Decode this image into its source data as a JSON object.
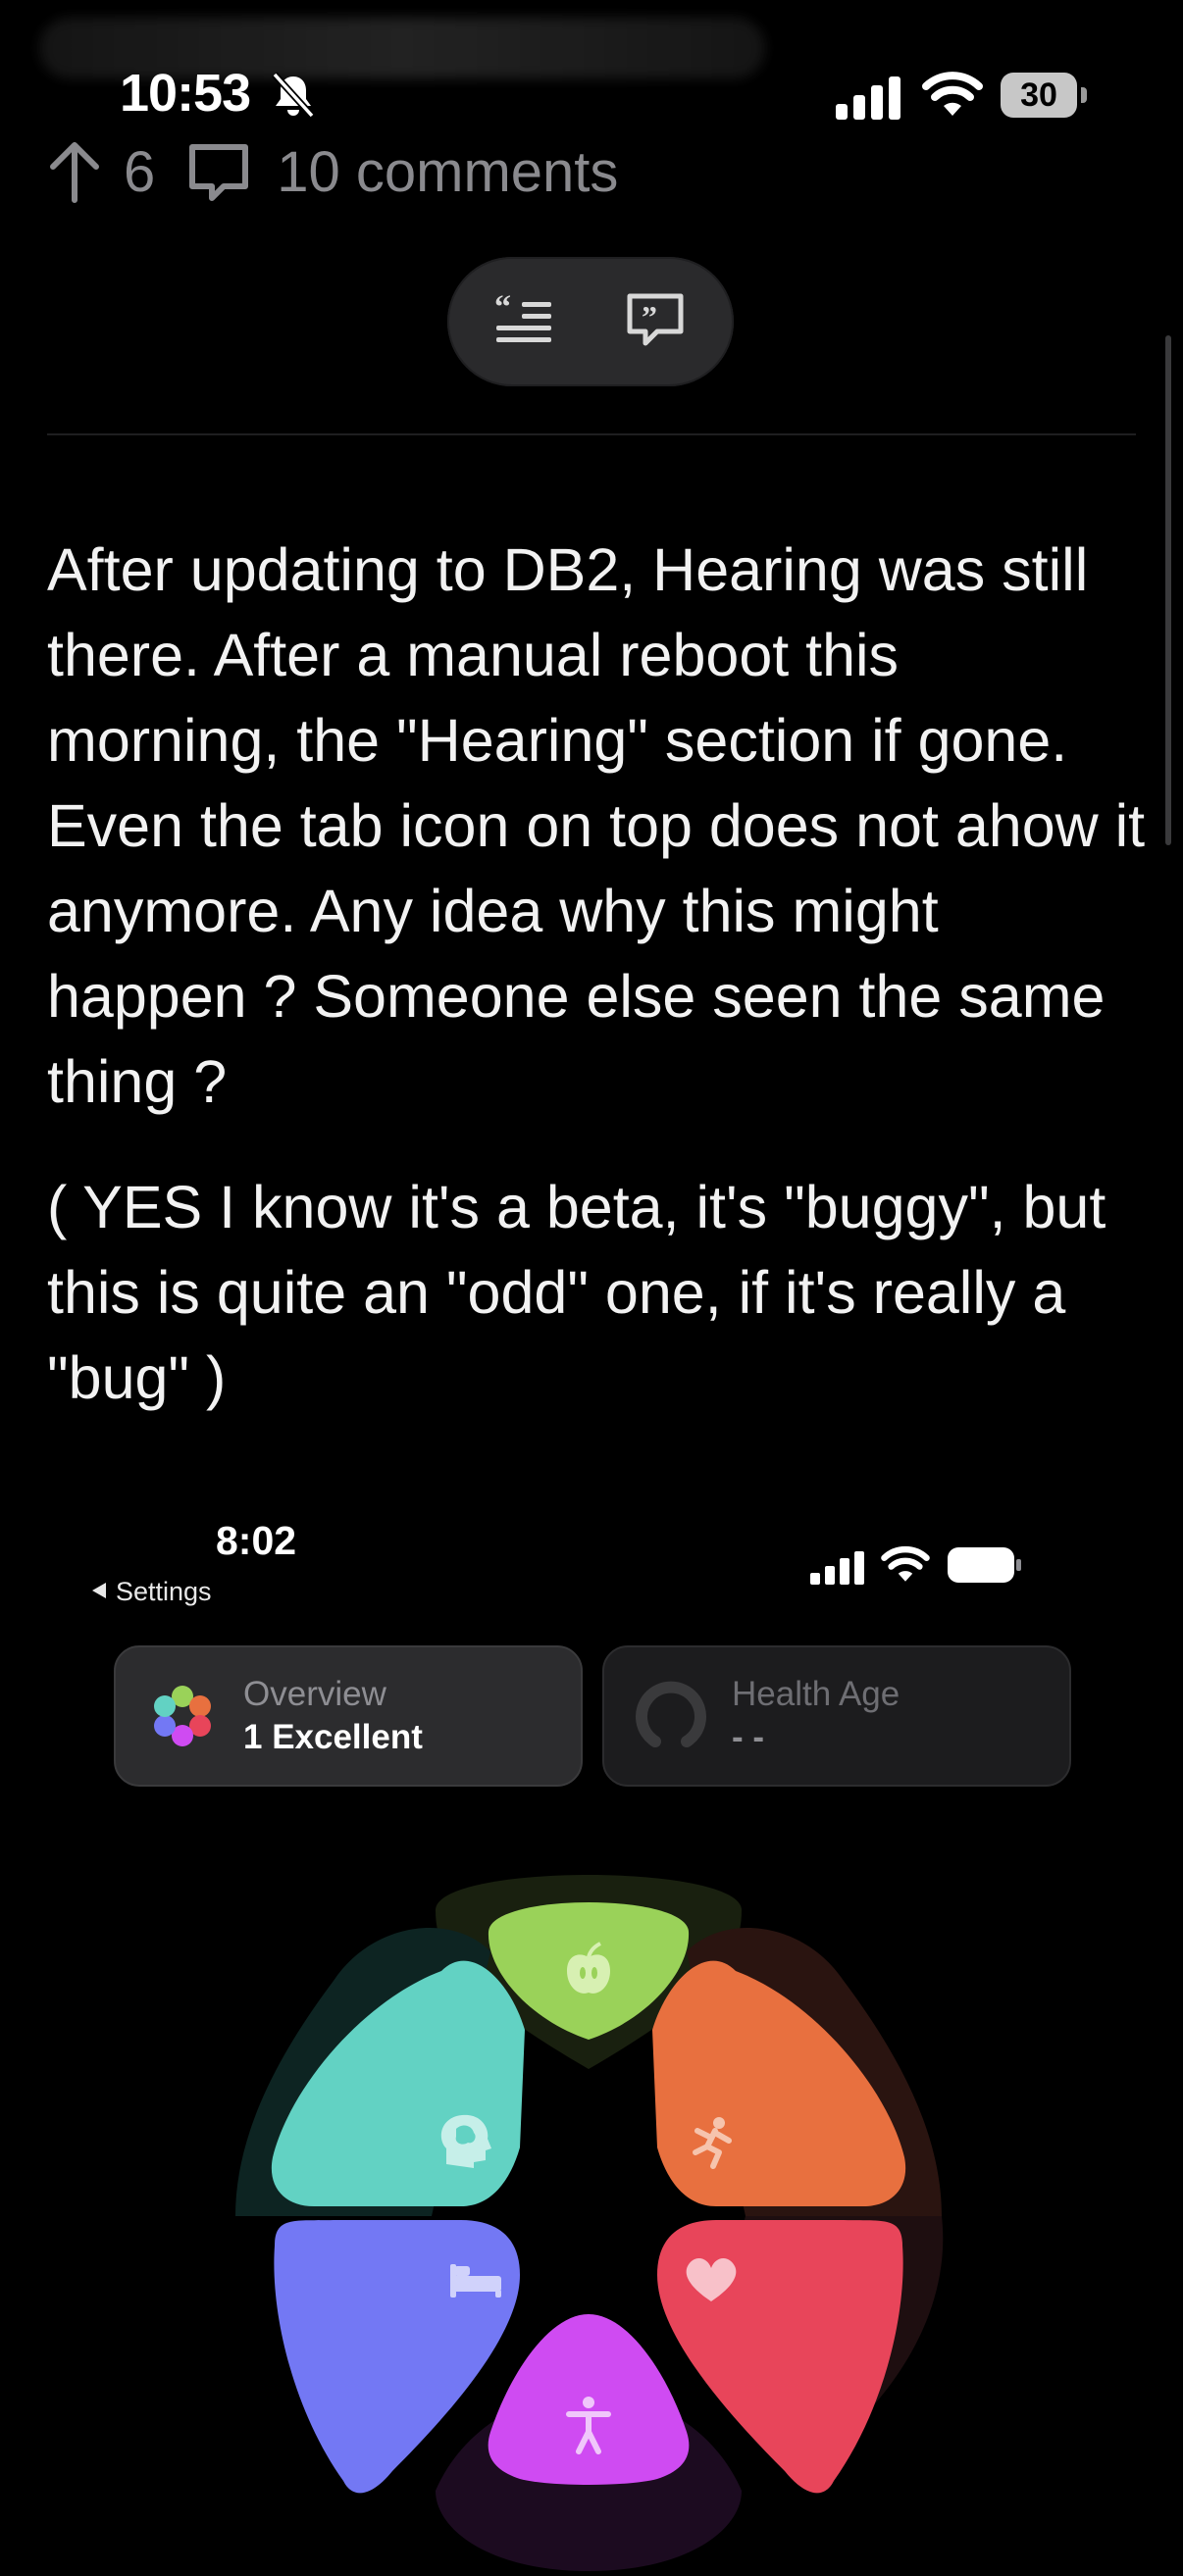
{
  "status_bar": {
    "time": "10:53",
    "battery": "30"
  },
  "vote_row": {
    "score": "6",
    "comments": "10 comments"
  },
  "post": {
    "paragraph1": "After updating to DB2, Hearing was still there. After a manual reboot this morning, the \"Hearing\" section if gone. Even the tab icon on top does not ahow it anymore. Any idea why this might happen ? Someone else seen the same thing ?",
    "paragraph2": "( YES I know it's a beta, it's \"buggy\", but this is quite an \"odd\" one, if it's really a \"bug\" )"
  },
  "embedded_screenshot": {
    "time": "8:02",
    "back_label": "Settings",
    "cards": [
      {
        "title": "Overview",
        "value": "1 Excellent"
      },
      {
        "title": "Health Age",
        "value": "- -"
      }
    ],
    "petal_colors": {
      "nutrition": "#9ad259",
      "activity": "#e8703f",
      "heart": "#e8455a",
      "mobility": "#cf4bf2",
      "sleep": "#7378f4",
      "mind": "#62d2c3"
    },
    "petal_icons": [
      "apple-icon",
      "running-icon",
      "heart-icon",
      "accessibility-icon",
      "bed-icon",
      "brain-head-icon"
    ]
  }
}
